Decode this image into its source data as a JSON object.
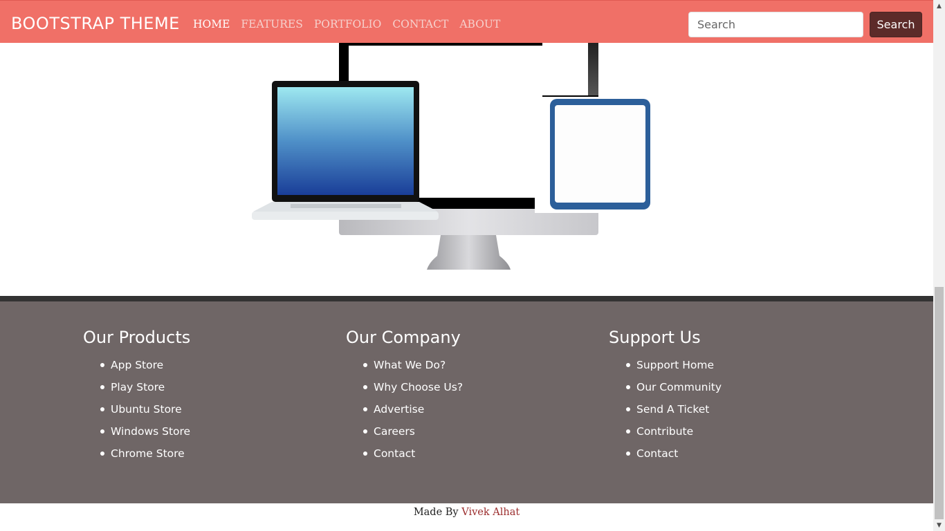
{
  "navbar": {
    "brand": "BOOTSTRAP THEME",
    "links": [
      "HOME",
      "FEATURES",
      "PORTFOLIO",
      "CONTACT",
      "ABOUT"
    ],
    "active_link": "HOME",
    "search_placeholder": "Search",
    "search_button": "Search"
  },
  "footer": {
    "columns": [
      {
        "title": "Our Products",
        "items": [
          "App Store",
          "Play Store",
          "Ubuntu Store",
          "Windows Store",
          "Chrome Store"
        ]
      },
      {
        "title": "Our Company",
        "items": [
          "What We Do?",
          "Why Choose Us?",
          "Advertise",
          "Careers",
          "Contact"
        ]
      },
      {
        "title": "Support Us",
        "items": [
          "Support Home",
          "Our Community",
          "Send A Ticket",
          "Contribute",
          "Contact"
        ]
      }
    ],
    "credit_prefix": "Made By",
    "credit_name": "Vivek Alhat"
  },
  "colors": {
    "navbar": "#f07067",
    "search_button": "#5c2b29",
    "footer": "#6f6666",
    "credit_link": "#9b2c2c"
  }
}
